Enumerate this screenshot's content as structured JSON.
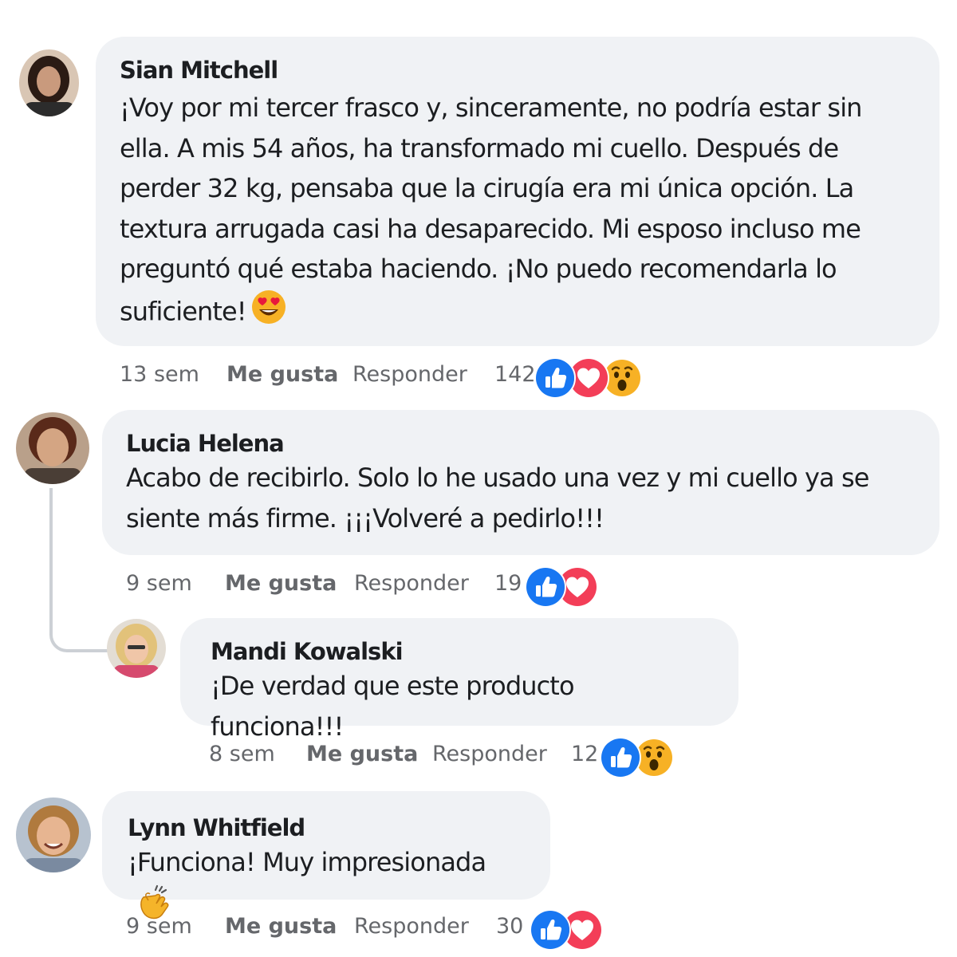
{
  "comments": [
    {
      "author": "Sian Mitchell",
      "text": "¡Voy por mi tercer frasco y, sinceramente, no podría estar sin ella. A mis 54 años, ha transformado mi cuello. Después de perder 32 kg, pensaba que la cirugía era mi única opción. La textura arrugada casi ha desaparecido. Mi esposo incluso me preguntó qué estaba haciendo. ¡No puedo recomendarla lo suficiente!",
      "emoji": "heart-eyes-emoji",
      "time": "13 sem",
      "like_label": "Me gusta",
      "reply_label": "Responder",
      "reaction_count": "142",
      "reactions": [
        "like",
        "love",
        "wow"
      ]
    },
    {
      "author": "Lucia Helena",
      "text": "Acabo de recibirlo. Solo lo he usado una vez y mi cuello ya se siente más firme. ¡¡¡Volveré a pedirlo!!!",
      "time": "9 sem",
      "like_label": "Me gusta",
      "reply_label": "Responder",
      "reaction_count": "19",
      "reactions": [
        "like",
        "love"
      ]
    },
    {
      "author": "Mandi Kowalski",
      "text": "¡De verdad que este producto funciona!!!",
      "time": "8 sem",
      "like_label": "Me gusta",
      "reply_label": "Responder",
      "reaction_count": "12",
      "reactions": [
        "like",
        "wow"
      ]
    },
    {
      "author": "Lynn Whitfield",
      "text": "¡Funciona! Muy impresionada",
      "emoji": "clapping-hands-emoji",
      "time": "9 sem",
      "like_label": "Me gusta",
      "reply_label": "Responder",
      "reaction_count": "30",
      "reactions": [
        "like",
        "love"
      ]
    }
  ],
  "colors": {
    "bubble": "#f0f2f5",
    "meta_text": "#65676b",
    "like_blue": "#1877f2",
    "love_red": "#f33e58",
    "wow_yellow": "#f7b125"
  }
}
